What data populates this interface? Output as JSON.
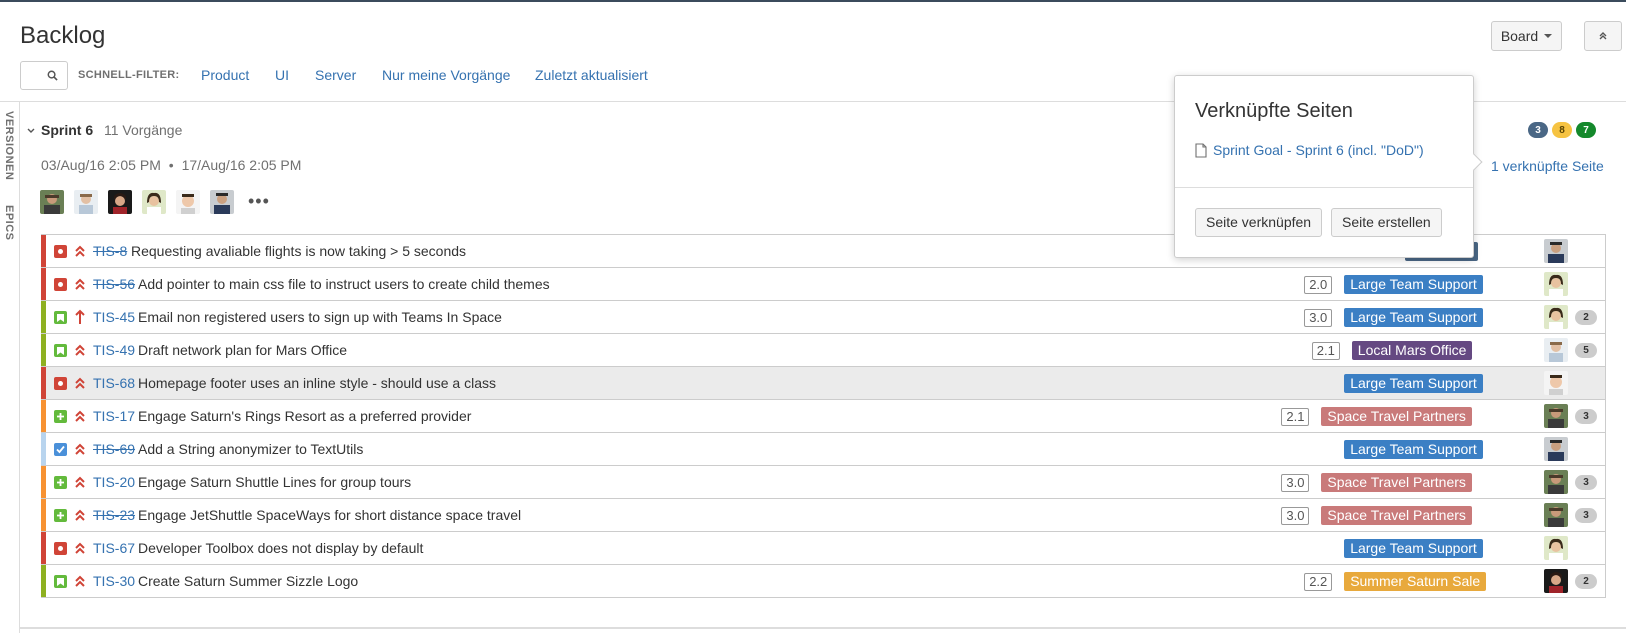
{
  "page": {
    "title": "Backlog"
  },
  "toolbar": {
    "board_label": "Board"
  },
  "quick_filters": {
    "label": "SCHNELL-FILTER:",
    "items": [
      "Product",
      "UI",
      "Server",
      "Nur meine Vorgänge",
      "Zuletzt aktualisiert"
    ]
  },
  "side_tabs": [
    "VERSIONEN",
    "EPICS"
  ],
  "sprint": {
    "name": "Sprint 6",
    "issue_count": "11 Vorgänge",
    "start": "03/Aug/16 2:05 PM",
    "separator": "•",
    "end": "17/Aug/16 2:05 PM",
    "more": "•••",
    "status_counts": [
      {
        "value": "3",
        "color": "#4a6785"
      },
      {
        "value": "8",
        "color": "#f6c342"
      },
      {
        "value": "7",
        "color": "#14892c"
      }
    ],
    "linked_pages_link": "1 verknüpfte Seite"
  },
  "popup": {
    "title": "Verknüpfte Seiten",
    "page_link": "Sprint Goal - Sprint 6 (incl. \"DoD\")",
    "link_button": "Seite verknüpfen",
    "create_button": "Seite erstellen"
  },
  "issues": [
    {
      "key": "TIS-8",
      "summary": "Requesting avaliable flights is now taking > 5 seconds",
      "done": true,
      "type": "bug",
      "priority": "highest",
      "estimate": "",
      "epic": "...EZ Plus",
      "epic_color": "#4a6785",
      "avatar": "a1",
      "subs": ""
    },
    {
      "key": "TIS-56",
      "summary": "Add pointer to main css file to instruct users to create child themes",
      "done": true,
      "type": "bug",
      "priority": "highest",
      "estimate": "2.0",
      "epic": "Large Team Support",
      "epic_color": "#3b7fc4",
      "avatar": "a2",
      "subs": ""
    },
    {
      "key": "TIS-45",
      "summary": "Email non registered users to sign up with Teams In Space",
      "done": false,
      "type": "story",
      "priority": "high",
      "estimate": "3.0",
      "epic": "Large Team Support",
      "epic_color": "#3b7fc4",
      "avatar": "a2",
      "subs": "2"
    },
    {
      "key": "TIS-49",
      "summary": "Draft network plan for Mars Office",
      "done": false,
      "type": "story",
      "priority": "highest",
      "estimate": "2.1",
      "epic": "Local Mars Office",
      "epic_color": "#654982",
      "avatar": "a3",
      "subs": "5"
    },
    {
      "key": "TIS-68",
      "summary": "Homepage footer uses an inline style - should use a class",
      "done": false,
      "type": "bug",
      "priority": "highest",
      "estimate": "",
      "epic": "Large Team Support",
      "epic_color": "#3b7fc4",
      "avatar": "a4",
      "subs": ""
    },
    {
      "key": "TIS-17",
      "summary": "Engage Saturn's Rings Resort as a preferred provider",
      "done": false,
      "type": "improvement",
      "priority": "highest",
      "estimate": "2.1",
      "epic": "Space Travel Partners",
      "epic_color": "#d04437",
      "avatar": "a5",
      "subs": "3"
    },
    {
      "key": "TIS-69",
      "summary": "Add a String anonymizer to TextUtils",
      "done": true,
      "type": "task",
      "priority": "highest",
      "estimate": "",
      "epic": "Large Team Support",
      "epic_color": "#3b7fc4",
      "avatar": "a1",
      "subs": ""
    },
    {
      "key": "TIS-20",
      "summary": "Engage Saturn Shuttle Lines for group tours",
      "done": false,
      "type": "improvement",
      "priority": "highest",
      "estimate": "3.0",
      "epic": "Space Travel Partners",
      "epic_color": "#d04437",
      "avatar": "a5",
      "subs": "3"
    },
    {
      "key": "TIS-23",
      "summary": "Engage JetShuttle SpaceWays for short distance space travel",
      "done": true,
      "type": "improvement",
      "priority": "highest",
      "estimate": "3.0",
      "epic": "Space Travel Partners",
      "epic_color": "#d04437",
      "avatar": "a5",
      "subs": "3"
    },
    {
      "key": "TIS-67",
      "summary": "Developer Toolbox does not display by default",
      "done": false,
      "type": "bug",
      "priority": "highest",
      "estimate": "",
      "epic": "Large Team Support",
      "epic_color": "#3b7fc4",
      "avatar": "a2",
      "subs": ""
    },
    {
      "key": "TIS-30",
      "summary": "Create Saturn Summer Sizzle Logo",
      "done": false,
      "type": "story",
      "priority": "highest",
      "estimate": "2.2",
      "epic": "Summer Saturn Sale",
      "epic_color": "#f6c342",
      "avatar": "a6",
      "subs": "2"
    }
  ],
  "colors": {
    "link": "#3572b0",
    "bug": "#d04437",
    "story": "#14892c",
    "improvement": "#14892c",
    "task": "#4a90d9"
  }
}
